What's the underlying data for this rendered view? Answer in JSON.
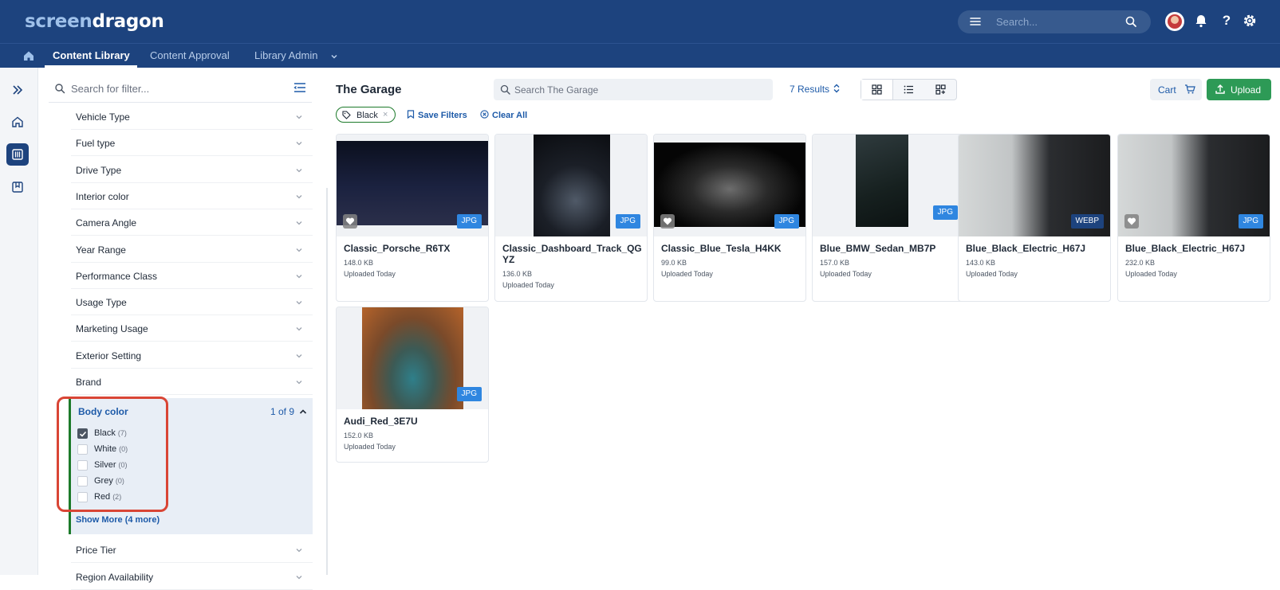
{
  "app": {
    "logo_part1": "screen",
    "logo_part2": "dragon"
  },
  "topbar": {
    "search_placeholder": "Search...",
    "icons": [
      "menu-icon",
      "search-icon",
      "avatar",
      "bell-icon",
      "help-icon",
      "gear-icon"
    ],
    "help_glyph": "?"
  },
  "subnav": {
    "items": [
      {
        "label": "Content Library",
        "active": true
      },
      {
        "label": "Content Approval",
        "active": false
      },
      {
        "label": "Library Admin",
        "active": false
      }
    ]
  },
  "filters": {
    "search_placeholder": "Search for filter...",
    "facets": [
      "Vehicle Type",
      "Fuel type",
      "Drive Type",
      "Interior color",
      "Camera Angle",
      "Year Range",
      "Performance Class",
      "Usage Type",
      "Marketing Usage",
      "Exterior Setting",
      "Brand"
    ],
    "body_color": {
      "label": "Body color",
      "count_text": "1 of 9",
      "options": [
        {
          "name": "Black",
          "count": "(7)",
          "checked": true
        },
        {
          "name": "White",
          "count": "(0)",
          "checked": false
        },
        {
          "name": "Silver",
          "count": "(0)",
          "checked": false
        },
        {
          "name": "Grey",
          "count": "(0)",
          "checked": false
        },
        {
          "name": "Red",
          "count": "(2)",
          "checked": false
        }
      ],
      "show_more": "Show More (4 more)"
    },
    "facets_after": [
      "Price Tier",
      "Region Availability"
    ]
  },
  "main": {
    "title": "The Garage",
    "search_placeholder": "Search The Garage",
    "results": "7 Results",
    "cart_label": "Cart",
    "upload_label": "Upload",
    "active_filter_chip": "Black",
    "chip_close": "×",
    "save_filters": "Save Filters",
    "clear_all": "Clear All"
  },
  "assets": [
    {
      "name": "Classic_Porsche_R6TX",
      "size": "148.0 KB",
      "uploaded": "Uploaded Today",
      "format": "JPG",
      "favorite": true
    },
    {
      "name": "Classic_Dashboard_Track_QGYZ",
      "size": "136.0 KB",
      "uploaded": "Uploaded Today",
      "format": "JPG",
      "favorite": false
    },
    {
      "name": "Classic_Blue_Tesla_H4KK",
      "size": "99.0 KB",
      "uploaded": "Uploaded Today",
      "format": "JPG",
      "favorite": true
    },
    {
      "name": "Blue_BMW_Sedan_MB7P",
      "size": "157.0 KB",
      "uploaded": "Uploaded Today",
      "format": "JPG",
      "favorite": false
    },
    {
      "name": "Blue_Black_Electric_H67J",
      "size": "143.0 KB",
      "uploaded": "Uploaded Today",
      "format": "WEBP",
      "favorite": false
    },
    {
      "name": "Blue_Black_Electric_H67J",
      "size": "232.0 KB",
      "uploaded": "Uploaded Today",
      "format": "JPG",
      "favorite": true
    },
    {
      "name": "Audi_Red_3E7U",
      "size": "152.0 KB",
      "uploaded": "Uploaded Today",
      "format": "JPG",
      "favorite": false
    }
  ],
  "colors": {
    "topbar": "#1d437e",
    "accent_link": "#1d5aa8",
    "upload_green": "#2d9a56",
    "badge_blue": "#2f86e0",
    "highlight_red": "#d94535"
  }
}
